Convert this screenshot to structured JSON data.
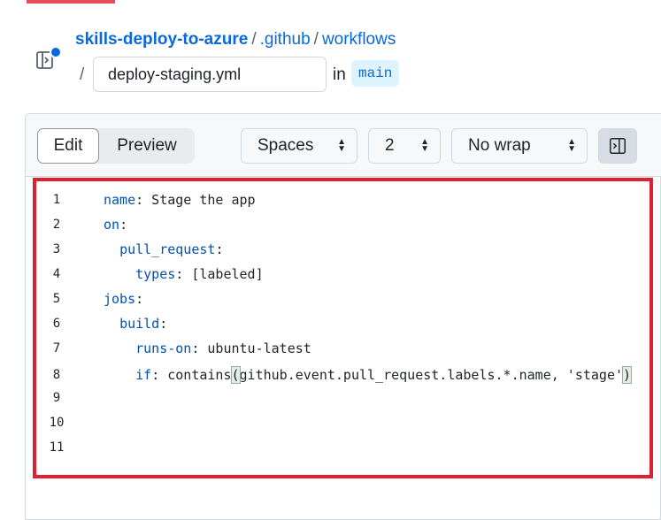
{
  "breadcrumb": {
    "repo": "skills-deploy-to-azure",
    "sep1": "/",
    "folder1": ".github",
    "sep2": "/",
    "folder2": "workflows",
    "sep3": "/"
  },
  "file": {
    "name": "deploy-staging.yml",
    "in_label": "in",
    "branch": "main"
  },
  "toolbar": {
    "edit_label": "Edit",
    "preview_label": "Preview",
    "indent_mode": "Spaces",
    "indent_size": "2",
    "wrap_mode": "No wrap"
  },
  "code": {
    "lines": [
      {
        "num": "1",
        "indent": "",
        "key": "name",
        "rest": ": Stage the app"
      },
      {
        "num": "2",
        "indent": "",
        "key": "on",
        "rest": ":"
      },
      {
        "num": "3",
        "indent": "  ",
        "key": "pull_request",
        "rest": ":"
      },
      {
        "num": "4",
        "indent": "    ",
        "key": "types",
        "rest": ": [labeled]"
      },
      {
        "num": "5",
        "indent": "",
        "key": "jobs",
        "rest": ":"
      },
      {
        "num": "6",
        "indent": "  ",
        "key": "build",
        "rest": ":"
      },
      {
        "num": "7",
        "indent": "    ",
        "key": "runs-on",
        "rest": ": ubuntu-latest"
      },
      {
        "num": "8",
        "indent": "    ",
        "key": "if",
        "pre": ": contains",
        "open": "(",
        "mid": "github.event.pull_request.labels.*.name, 'stage'",
        "close": ")"
      },
      {
        "num": "9"
      },
      {
        "num": "10"
      },
      {
        "num": "11"
      }
    ]
  },
  "colors": {
    "link": "#0969da",
    "yaml_key": "#0550ae",
    "highlight_border": "#e0202e"
  }
}
